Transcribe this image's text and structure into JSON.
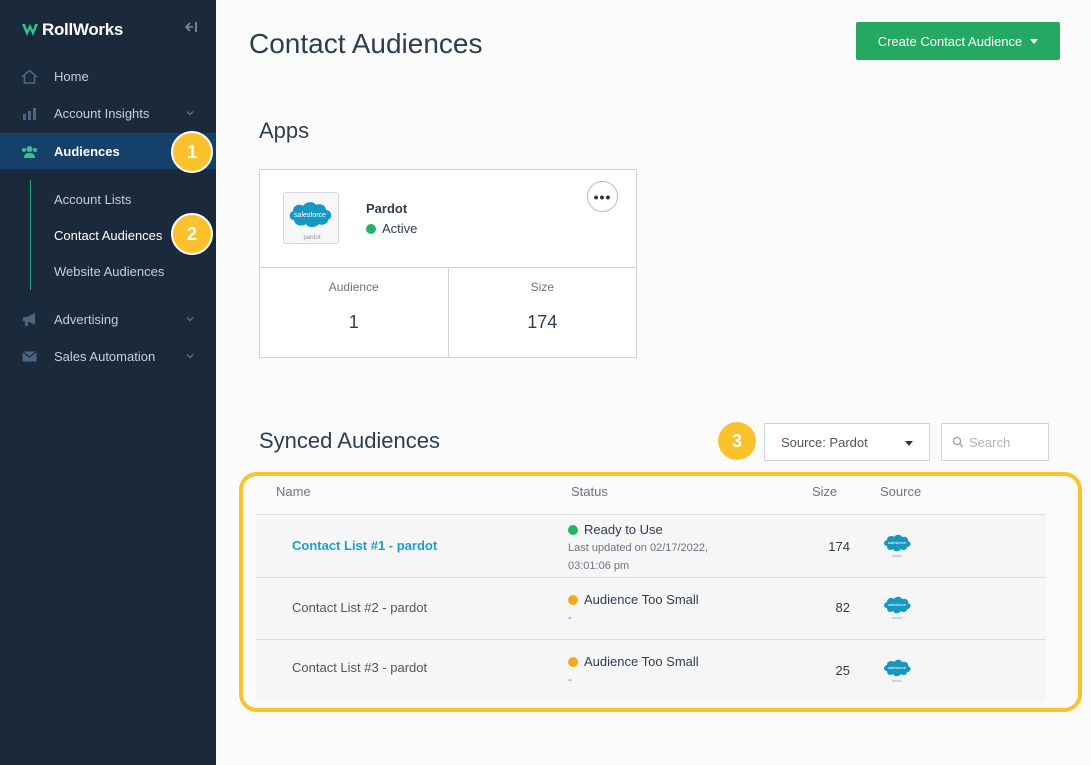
{
  "sidebar": {
    "brand": "RollWorks",
    "nav": [
      {
        "label": "Home",
        "icon": "home-icon"
      },
      {
        "label": "Account Insights",
        "icon": "chart-icon"
      },
      {
        "label": "Audiences",
        "icon": "people-icon"
      },
      {
        "label": "Advertising",
        "icon": "megaphone-icon"
      },
      {
        "label": "Sales Automation",
        "icon": "mail-icon"
      }
    ],
    "sub_items": [
      "Account Lists",
      "Contact Audiences",
      "Website Audiences"
    ],
    "accent_color": "#31c48d",
    "background": "#1b2a3b"
  },
  "callouts": [
    "1",
    "2",
    "3"
  ],
  "header": {
    "title": "Contact Audiences",
    "create_button": "Create Contact Audience"
  },
  "apps": {
    "section_title": "Apps",
    "app": {
      "name": "Pardot",
      "status": "Active",
      "status_color": "#25b36a",
      "logo_text": "salesforce",
      "logo_subtext": "pardot",
      "more_label": "•••",
      "audience_label": "Audience",
      "audience_value": "1",
      "size_label": "Size",
      "size_value": "174"
    }
  },
  "synced": {
    "section_title": "Synced Audiences",
    "source_filter": "Source: Pardot",
    "search_placeholder": "Search",
    "columns": {
      "name": "Name",
      "status": "Status",
      "size": "Size",
      "source": "Source"
    },
    "rows": [
      {
        "name": "Contact List #1 - pardot",
        "status": "Ready to Use",
        "status_color": "#25b36a",
        "sub1": "Last updated on 02/17/2022,",
        "sub2": "03:01:06 pm",
        "size": "174",
        "source_icon": "salesforce-pardot-icon"
      },
      {
        "name": "Contact List #2 - pardot",
        "status": "Audience Too Small",
        "status_color": "#f5a623",
        "sub1": "-",
        "sub2": "",
        "size": "82",
        "source_icon": "salesforce-pardot-icon"
      },
      {
        "name": "Contact List #3 - pardot",
        "status": "Audience Too Small",
        "status_color": "#f5a623",
        "sub1": "-",
        "sub2": "",
        "size": "25",
        "source_icon": "salesforce-pardot-icon"
      }
    ]
  },
  "highlight_color": "#fcc22e"
}
